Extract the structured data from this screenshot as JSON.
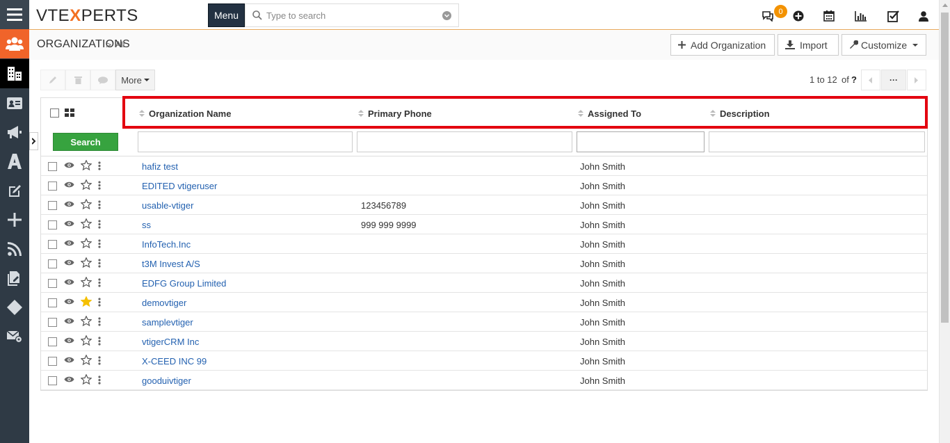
{
  "app": {
    "logo_prefix": "VTE",
    "logo_accent": "X",
    "logo_suffix": "PERTS",
    "menu_label": "Menu",
    "search_placeholder": "Type to search",
    "notification_count": "0"
  },
  "colors": {
    "rail": "#2f3a45",
    "accent_orange": "#f0642a",
    "highlight_red": "#e3000f",
    "search_green": "#37a33f",
    "link_blue": "#2361b0"
  },
  "header": {
    "module_title": "ORGANIZATIONS",
    "breadcrumb_sep": ">",
    "breadcrumb_view": "All",
    "add_label": "Add Organization",
    "import_label": "Import",
    "customize_label": "Customize"
  },
  "actions": {
    "more_label": "More",
    "pagination_range": "1 to 12",
    "pagination_of": "of",
    "pagination_total": "?",
    "more_pages": "···"
  },
  "list": {
    "columns": [
      {
        "label": "Organization Name"
      },
      {
        "label": "Primary Phone"
      },
      {
        "label": "Assigned To"
      },
      {
        "label": "Description"
      }
    ],
    "search_label": "Search",
    "rows": [
      {
        "name": "hafiz test",
        "phone": "",
        "assigned": "John Smith",
        "description": "",
        "starred": false
      },
      {
        "name": "EDITED vtigeruser",
        "phone": "",
        "assigned": "John Smith",
        "description": "",
        "starred": false
      },
      {
        "name": "usable-vtiger",
        "phone": "123456789",
        "assigned": "John Smith",
        "description": "",
        "starred": false
      },
      {
        "name": "ss",
        "phone": "999 999 9999",
        "assigned": "John Smith",
        "description": "",
        "starred": false
      },
      {
        "name": "InfoTech.Inc",
        "phone": "",
        "assigned": "John Smith",
        "description": "",
        "starred": false
      },
      {
        "name": "t3M Invest A/S",
        "phone": "",
        "assigned": "John Smith",
        "description": "",
        "starred": false
      },
      {
        "name": "EDFG Group Limited",
        "phone": "",
        "assigned": "John Smith",
        "description": "",
        "starred": false
      },
      {
        "name": "demovtiger",
        "phone": "",
        "assigned": "John Smith",
        "description": "",
        "starred": true
      },
      {
        "name": "samplevtiger",
        "phone": "",
        "assigned": "John Smith",
        "description": "",
        "starred": false
      },
      {
        "name": "vtigerCRM Inc",
        "phone": "",
        "assigned": "John Smith",
        "description": "",
        "starred": false
      },
      {
        "name": "X-CEED INC 99",
        "phone": "",
        "assigned": "John Smith",
        "description": "",
        "starred": false
      },
      {
        "name": "gooduivtiger",
        "phone": "",
        "assigned": "John Smith",
        "description": "",
        "starred": false
      }
    ]
  }
}
